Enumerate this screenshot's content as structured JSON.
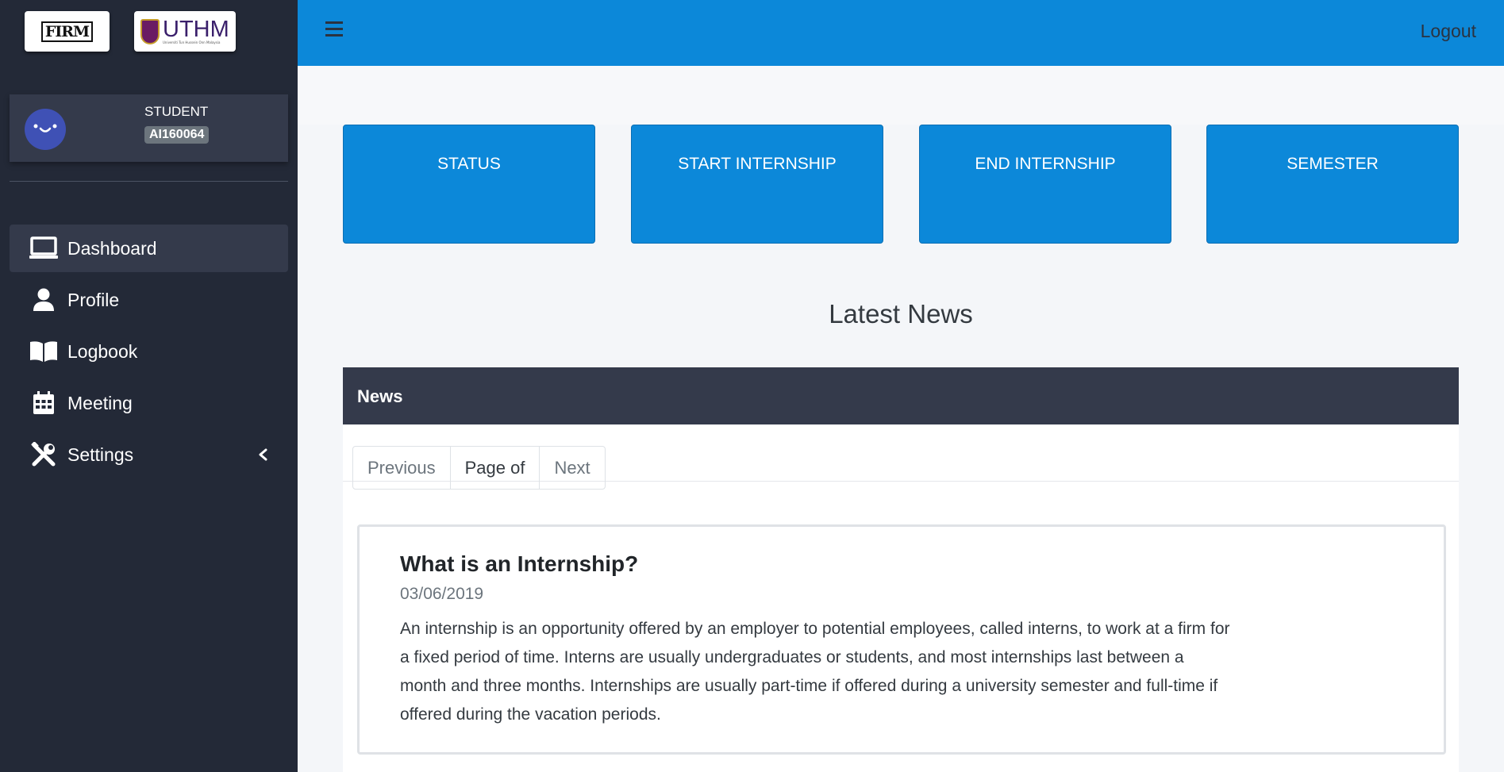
{
  "brand": {
    "firm_logo_text": "FIRM",
    "uthm_logo_text": "UTHM",
    "uthm_logo_subtext": "Universiti Tun Hussein Onn Malaysia"
  },
  "user": {
    "role": "STUDENT",
    "id": "AI160064"
  },
  "sidebar": {
    "items": [
      {
        "label": "Dashboard",
        "icon": "laptop-icon"
      },
      {
        "label": "Profile",
        "icon": "user-icon"
      },
      {
        "label": "Logbook",
        "icon": "book-icon"
      },
      {
        "label": "Meeting",
        "icon": "calendar-icon"
      },
      {
        "label": "Settings",
        "icon": "tools-icon"
      }
    ]
  },
  "header": {
    "logout_label": "Logout"
  },
  "tiles": [
    {
      "label": "STATUS"
    },
    {
      "label": "START INTERNSHIP"
    },
    {
      "label": "END INTERNSHIP"
    },
    {
      "label": "SEMESTER"
    }
  ],
  "news_section": {
    "title": "Latest News",
    "card_header": "News",
    "pager": {
      "previous": "Previous",
      "current": "Page of",
      "next": "Next"
    },
    "items": [
      {
        "title": "What is an Internship?",
        "date": "03/06/2019",
        "body": "An internship is an opportunity offered by an employer to potential employees, called interns, to work at a firm for a fixed period of time. Interns are usually undergraduates or students, and most internships last between a month and three months. Internships are usually part-time if offered during a university semester and full-time if offered during the vacation periods."
      }
    ]
  },
  "colors": {
    "sidebar_bg": "#232937",
    "accent_blue": "#0c88d9",
    "panel_bg": "#343a4b"
  }
}
